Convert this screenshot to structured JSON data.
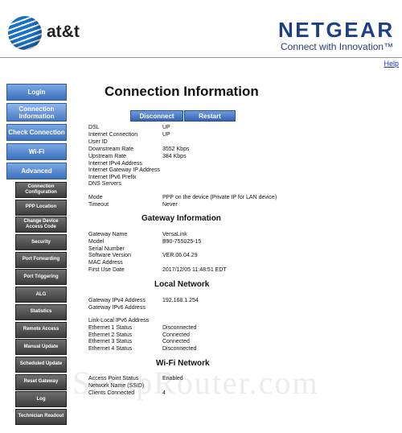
{
  "header": {
    "att_text": "at&t",
    "netgear_title": "NETGEAR",
    "netgear_tagline": "Connect with Innovation™",
    "help_link": "Help"
  },
  "sidebar": {
    "main_items": [
      {
        "label": "Login"
      },
      {
        "label": "Connection Information"
      },
      {
        "label": "Check Connection"
      },
      {
        "label": "Wi-Fi"
      },
      {
        "label": "Advanced"
      }
    ],
    "sub_items": [
      {
        "label": "Connection Configuration"
      },
      {
        "label": "PPP Location"
      },
      {
        "label": "Change Device Access Code"
      },
      {
        "label": "Security"
      },
      {
        "label": "Port Forwarding"
      },
      {
        "label": "Port Triggering"
      },
      {
        "label": "ALG"
      },
      {
        "label": "Statistics"
      },
      {
        "label": "Remote Access"
      },
      {
        "label": "Manual Update"
      },
      {
        "label": "Scheduled Update"
      },
      {
        "label": "Reset Gateway"
      },
      {
        "label": "Log"
      },
      {
        "label": "Technician Readout"
      }
    ]
  },
  "main": {
    "title": "Connection Information",
    "disconnect_label": "Disconnect",
    "restart_label": "Restart",
    "connection": [
      {
        "key": "DSL",
        "value": "UP"
      },
      {
        "key": "Internet Connection",
        "value": "UP"
      },
      {
        "key": "User ID",
        "value": ""
      },
      {
        "key": "Downstream Rate",
        "value": "3552 Kbps"
      },
      {
        "key": "Upstream Rate",
        "value": "384 Kbps"
      },
      {
        "key": "Internet IPv4 Address",
        "value": ""
      },
      {
        "key": "Internet Gateway IP Address",
        "value": ""
      },
      {
        "key": "Internet IPv6 Prefix",
        "value": ""
      },
      {
        "key": "DNS Servers",
        "value": ""
      }
    ],
    "mode": [
      {
        "key": "Mode",
        "value": "PPP on the device (Private IP for LAN device)"
      },
      {
        "key": "Timeout",
        "value": "Never"
      }
    ],
    "gateway_title": "Gateway Information",
    "gateway": [
      {
        "key": "Gateway Name",
        "value": "VersaLink"
      },
      {
        "key": "Model",
        "value": "B90-755025-15"
      },
      {
        "key": "Serial Number",
        "value": ""
      },
      {
        "key": "Software Version",
        "value": "VER.06.04.29"
      },
      {
        "key": "MAC Address",
        "value": ""
      },
      {
        "key": "First Use Date",
        "value": "2017/12/05 11:48:51 EDT"
      }
    ],
    "local_title": "Local Network",
    "local": [
      {
        "key": "Gateway IPv4 Address",
        "value": "192.168.1.254"
      },
      {
        "key": "Gateway IPv6 Address",
        "value": ""
      }
    ],
    "ports": [
      {
        "key": "Link-Local IPv6 Address",
        "value": ""
      },
      {
        "key": "Ethernet 1 Status",
        "value": "Disconnected"
      },
      {
        "key": "Ethernet 2 Status",
        "value": "Connected"
      },
      {
        "key": "Ethernet 3 Status",
        "value": "Connected"
      },
      {
        "key": "Ethernet 4 Status",
        "value": "Disconnected"
      }
    ],
    "wifi_title": "Wi-Fi Network",
    "wifi": [
      {
        "key": "Access Point Status",
        "value": "Enabled"
      },
      {
        "key": "Network Name (SSID)",
        "value": ""
      },
      {
        "key": "Clients Connected",
        "value": "4"
      }
    ]
  },
  "watermark": "SetupRouter.com"
}
